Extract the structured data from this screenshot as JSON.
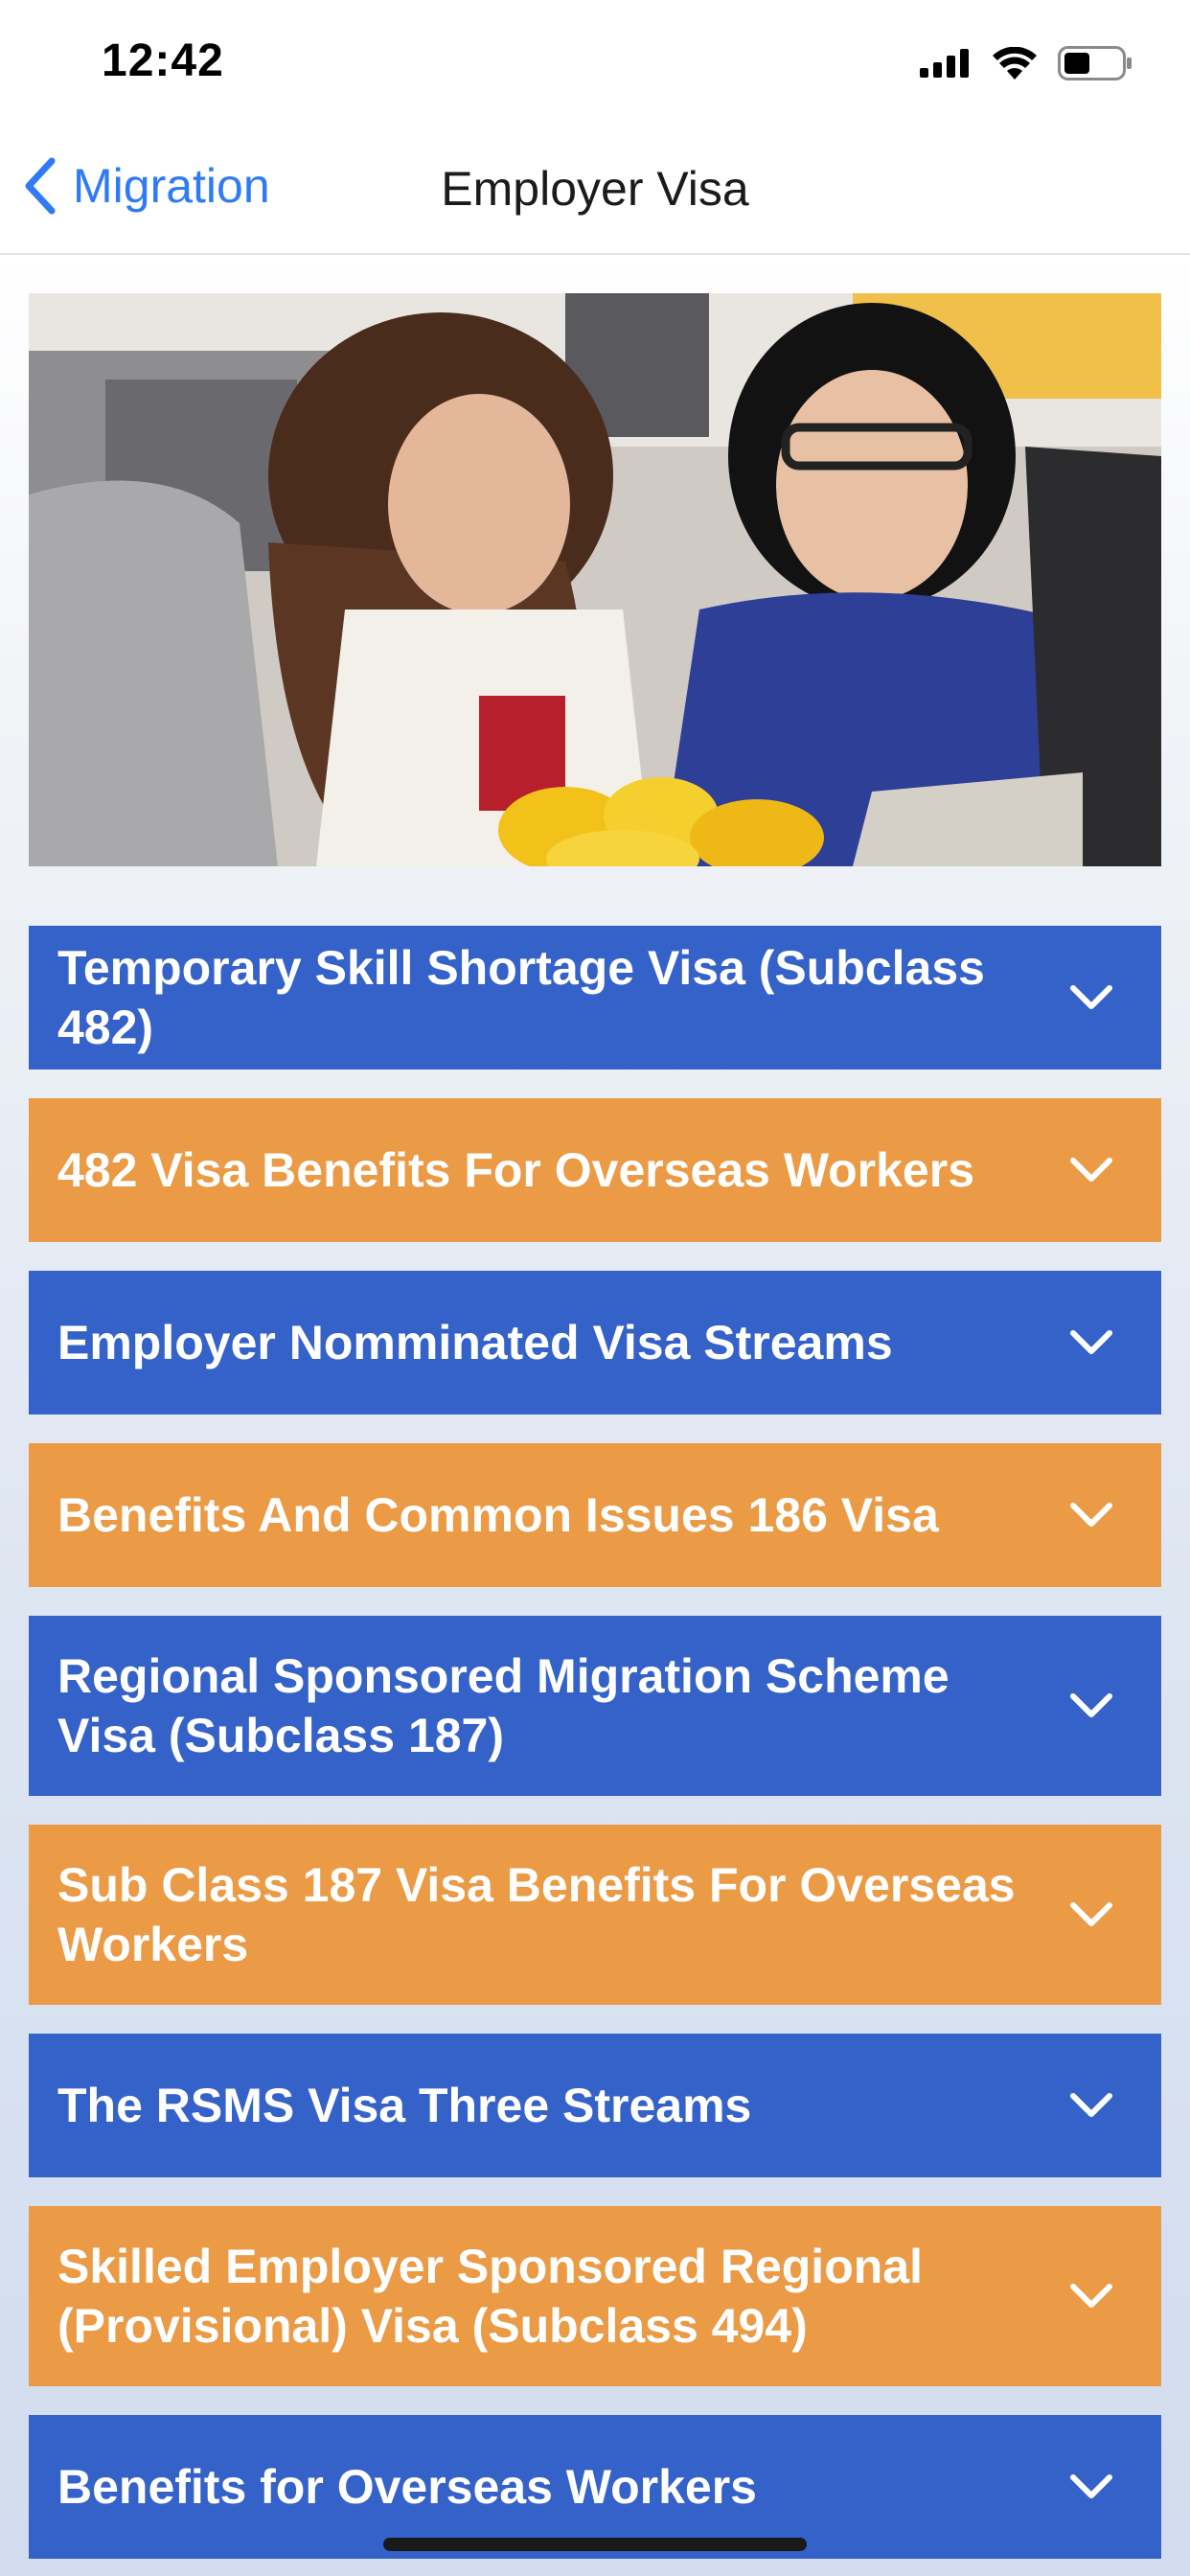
{
  "status_bar": {
    "time": "12:42",
    "icons": [
      "cellular-signal-icon",
      "wifi-icon",
      "battery-icon"
    ]
  },
  "nav": {
    "back_label": "Migration",
    "title": "Employer Visa",
    "accent_color": "#2f7bf5"
  },
  "hero": {
    "image": "photo of two women working at a laptop in an office"
  },
  "accordion": {
    "blue_color": "#3562c8",
    "orange_color": "#eb9a45",
    "items": [
      {
        "label": "Temporary Skill Shortage Visa (Subclass 482)",
        "color": "blue"
      },
      {
        "label": "482 Visa Benefits For Overseas Workers",
        "color": "orange"
      },
      {
        "label": "Employer Nomminated Visa Streams",
        "color": "blue"
      },
      {
        "label": "Benefits And Common Issues 186 Visa",
        "color": "orange"
      },
      {
        "label": "Regional Sponsored Migration Scheme Visa (Subclass 187)",
        "color": "blue"
      },
      {
        "label": "Sub Class 187 Visa Benefits For Overseas Workers",
        "color": "orange"
      },
      {
        "label": "The RSMS Visa Three Streams",
        "color": "blue"
      },
      {
        "label": "Skilled Employer Sponsored Regional (Provisional) Visa (Subclass 494)",
        "color": "orange"
      },
      {
        "label": "Benefits for Overseas Workers",
        "color": "blue"
      }
    ]
  }
}
